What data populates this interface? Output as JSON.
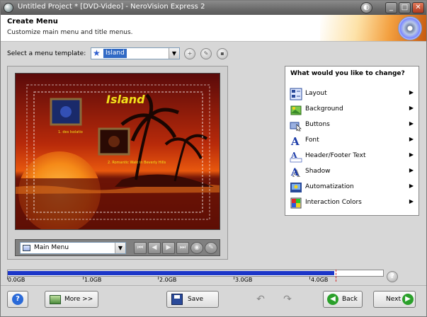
{
  "window": {
    "title": "Untitled Project * [DVD-Video] - NeroVision Express 2",
    "controls": {
      "minimize": "_",
      "maximize": "□",
      "close": "✕"
    }
  },
  "header": {
    "title": "Create Menu",
    "subtitle": "Customize main menu and title menus."
  },
  "template": {
    "label": "Select a menu template:",
    "selected": "Island"
  },
  "preview": {
    "menu_title": "Island",
    "item1_caption": "1. des Isolatio",
    "item2_caption": "2. Romantic Walk in Beverly Hills"
  },
  "menu_selector": {
    "selected": "Main Menu"
  },
  "change_panel": {
    "title": "What would you like to change?",
    "items": [
      {
        "label": "Layout",
        "icon": "layout-icon"
      },
      {
        "label": "Background",
        "icon": "background-icon"
      },
      {
        "label": "Buttons",
        "icon": "buttons-icon"
      },
      {
        "label": "Font",
        "icon": "font-icon"
      },
      {
        "label": "Header/Footer Text",
        "icon": "header-footer-text-icon"
      },
      {
        "label": "Shadow",
        "icon": "shadow-icon"
      },
      {
        "label": "Automatization",
        "icon": "automatization-icon"
      },
      {
        "label": "Interaction Colors",
        "icon": "interaction-colors-icon"
      }
    ]
  },
  "capacity": {
    "ticks": [
      "0.0GB",
      "1.0GB",
      "2.0GB",
      "3.0GB",
      "4.0GB"
    ],
    "used_fraction": 0.87,
    "limit_fraction": 0.875
  },
  "buttons": {
    "help": "?",
    "more": "More >>",
    "save": "Save",
    "back": "Back",
    "next": "Next"
  },
  "colors": {
    "accent_blue": "#1c36c8",
    "selection": "#316ac5",
    "back_next_green": "#2aa02a",
    "menu_title_yellow": "#f2e21a"
  }
}
